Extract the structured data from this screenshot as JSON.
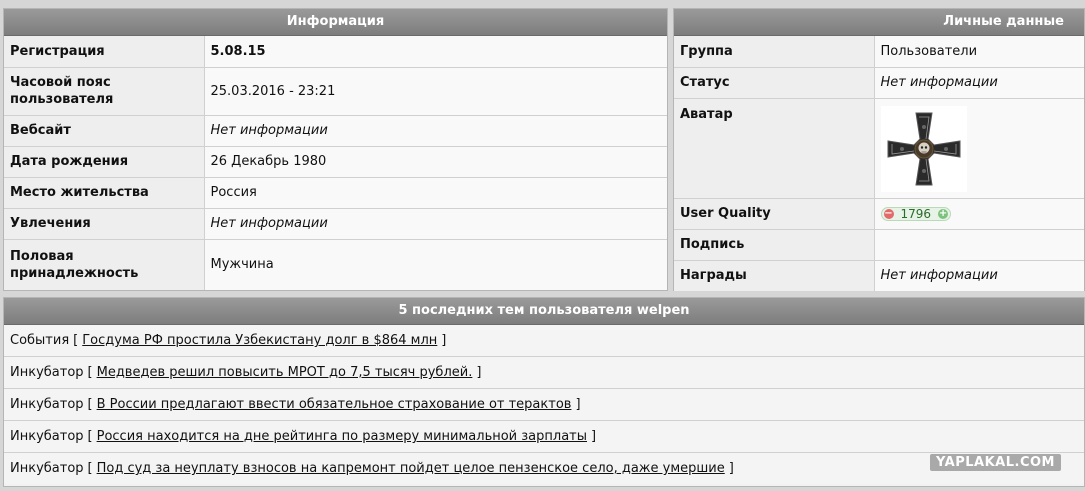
{
  "info": {
    "title": "Информация",
    "rows": [
      {
        "label": "Регистрация",
        "value": "5.08.15"
      },
      {
        "label": "Часовой пояс пользователя",
        "value": "25.03.2016 - 23:21"
      },
      {
        "label": "Вебсайт",
        "value": "Нет информации"
      },
      {
        "label": "Дата рождения",
        "value": "26 Декабрь 1980"
      },
      {
        "label": "Место жительства",
        "value": "Россия"
      },
      {
        "label": "Увлечения",
        "value": "Нет информации"
      },
      {
        "label": "Половая принадлежность",
        "value": "Мужчина"
      }
    ]
  },
  "personal": {
    "title": "Личные данные",
    "group_label": "Группа",
    "group_value": "Пользователи",
    "status_label": "Статус",
    "status_value": "Нет информации",
    "avatar_label": "Аватар",
    "quality_label": "User Quality",
    "quality_value": "1796",
    "signature_label": "Подпись",
    "awards_label": "Награды",
    "awards_value": "Нет информации"
  },
  "topics": {
    "title": "5 последних тем пользователя welpen",
    "items": [
      {
        "section": "События",
        "link": "Госдума РФ простила Узбекистану долг в $864 млн"
      },
      {
        "section": "Инкубатор",
        "link": "Медведев решил повысить МРОТ до 7,5 тысяч рублей."
      },
      {
        "section": "Инкубатор",
        "link": "В России предлагают ввести обязательное страхование от терактов"
      },
      {
        "section": "Инкубатор",
        "link": "Россия находится на дне рейтинга по размеру минимальной зарплаты"
      },
      {
        "section": "Инкубатор",
        "link": "Под суд за неуплату взносов на капремонт пойдет целое пензенское село, даже умершие"
      }
    ]
  },
  "watermark": "YAPLAKAL.COM",
  "colors": {
    "header": "#8c8c8c",
    "background": "#d6d6d6",
    "quality_green": "#2b6b2b"
  }
}
